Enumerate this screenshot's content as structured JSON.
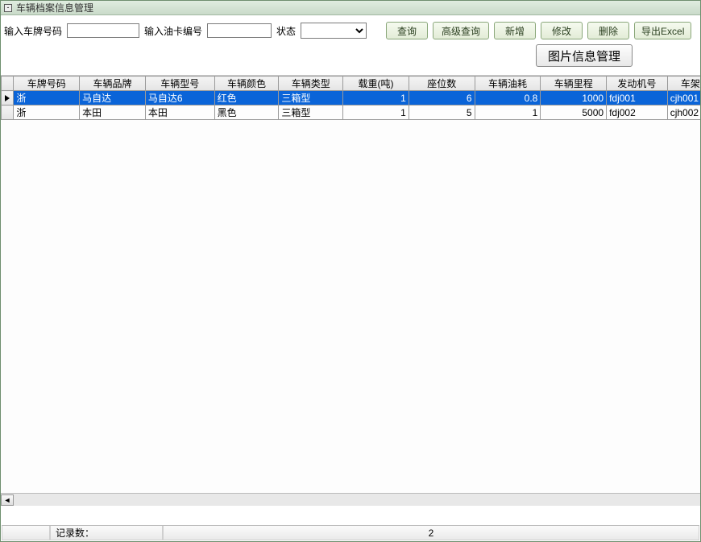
{
  "window": {
    "title": "车辆档案信息管理"
  },
  "toolbar": {
    "plate_label": "输入车牌号码",
    "plate_value": "",
    "card_label": "输入油卡编号",
    "card_value": "",
    "status_label": "状态",
    "status_value": "",
    "btn_query": "查询",
    "btn_adv_query": "高级查询",
    "btn_add": "新增",
    "btn_edit": "修改",
    "btn_delete": "删除",
    "btn_export": "导出Excel",
    "btn_image_mgmt": "图片信息管理"
  },
  "grid": {
    "columns": [
      "车牌号码",
      "车辆品牌",
      "车辆型号",
      "车辆颜色",
      "车辆类型",
      "载重(吨)",
      "座位数",
      "车辆油耗",
      "车辆里程",
      "发动机号",
      "车架"
    ],
    "rows": [
      {
        "selected": true,
        "cells": [
          "浙",
          "马自达",
          "马自达6",
          "红色",
          "三箱型",
          "1",
          "6",
          "0.8",
          "1000",
          "fdj001",
          "cjh001"
        ]
      },
      {
        "selected": false,
        "cells": [
          "浙",
          "本田",
          "本田",
          "黑色",
          "三箱型",
          "1",
          "5",
          "1",
          "5000",
          "fdj002",
          "cjh002"
        ]
      }
    ]
  },
  "statusbar": {
    "record_label": "记录数：",
    "record_count": "2"
  }
}
